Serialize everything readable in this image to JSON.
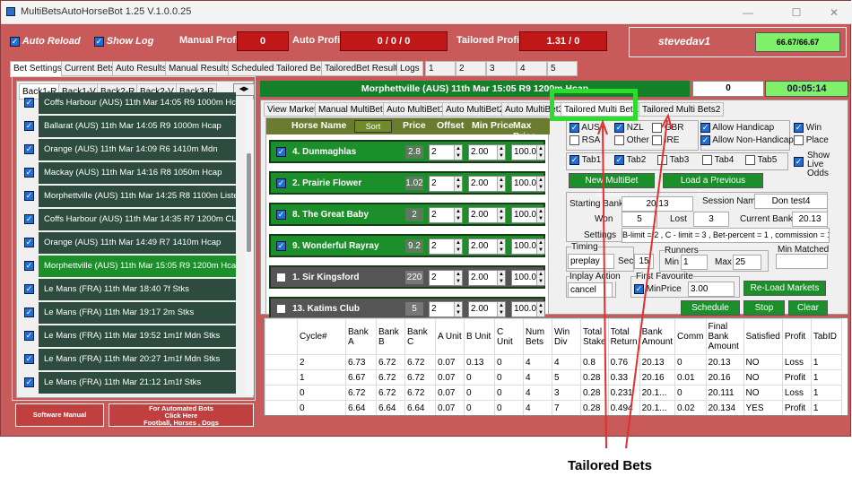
{
  "window": {
    "title": "MultiBetsAutoHorseBot 1.25 V.1.0.0.25",
    "minimize": "—",
    "maximize": "☐",
    "close": "✕"
  },
  "top": {
    "auto_reload": "Auto Reload",
    "show_log": "Show Log",
    "manual_profit_label": "Manual Profit",
    "manual_profit": "0",
    "auto_profit_label": "Auto Profit",
    "auto_profit": "0 / 0 / 0",
    "tailored_profit_label": "Tailored Profit",
    "tailored_profit": "1.31 / 0",
    "username": "stevedav1",
    "ratio": "66.67/66.67"
  },
  "tabs": [
    "Bet Settings",
    "Current Bets",
    "Auto Results",
    "Manual Results",
    "Scheduled Tailored Bets",
    "TailoredBet Results",
    "Logs",
    "1",
    "2",
    "3",
    "4",
    "5"
  ],
  "left": {
    "subtabs": [
      "Back1-R",
      "Back1-V",
      "Back2-R",
      "Back2-V",
      "Back3-R"
    ],
    "races": [
      {
        "name": "Coffs Harbour (AUS) 11th Mar 14:05 R9 1000m Hcap",
        "selected": false
      },
      {
        "name": "Ballarat (AUS) 11th Mar 14:05 R9 1000m Hcap",
        "selected": false
      },
      {
        "name": "Orange (AUS) 11th Mar 14:09 R6 1410m Mdn",
        "selected": false
      },
      {
        "name": "Mackay (AUS) 11th Mar 14:16 R8 1050m Hcap",
        "selected": false
      },
      {
        "name": "Morphettville (AUS) 11th Mar 14:25 R8 1100m Listed",
        "selected": false
      },
      {
        "name": "Coffs Harbour (AUS) 11th Mar 14:35 R7 1200m CL3",
        "selected": false
      },
      {
        "name": "Orange (AUS) 11th Mar 14:49 R7 1410m Hcap",
        "selected": false
      },
      {
        "name": "Morphettville (AUS) 11th Mar 15:05 R9 1200m Hcap",
        "selected": true
      },
      {
        "name": "Le Mans (FRA) 11th Mar 18:40 7f Stks",
        "selected": false
      },
      {
        "name": "Le Mans (FRA) 11th Mar 19:17 2m Stks",
        "selected": false
      },
      {
        "name": "Le Mans (FRA) 11th Mar 19:52 1m1f Mdn Stks",
        "selected": false
      },
      {
        "name": "Le Mans (FRA) 11th Mar 20:27 1m1f Mdn Stks",
        "selected": false
      },
      {
        "name": "Le Mans (FRA) 11th Mar 21:12 1m1f Stks",
        "selected": false
      }
    ],
    "software_manual": "Software Manual",
    "for_auto_1": "For Automated Bots",
    "for_auto_2": "Click Here",
    "for_auto_3": "Football, Horses , Dogs"
  },
  "main": {
    "header": "Morphettville (AUS) 11th Mar 15:05 R9 1200m Hcap",
    "header_count": "0",
    "timer": "00:05:14",
    "tabs": [
      "View Market",
      "Manual MultiBets",
      "Auto MultiBet1",
      "Auto MultiBet2",
      "Auto MultiBet3",
      "Tailored Multi Bets1",
      "Tailored Multi Bets2"
    ],
    "cols": {
      "horse": "Horse Name",
      "sort": "Sort",
      "price": "Price",
      "offset": "Offset",
      "min": "Min Price",
      "max": "Max Price"
    },
    "horses": [
      {
        "name": "4. Dunmaghlas",
        "price": "2.8",
        "offset": "2",
        "min": "2.00",
        "max": "100.0",
        "active": true
      },
      {
        "name": "2. Prairie Flower",
        "price": "1.02",
        "offset": "2",
        "min": "2.00",
        "max": "100.0",
        "active": true
      },
      {
        "name": "8. The Great Baby",
        "price": "2",
        "offset": "2",
        "min": "2.00",
        "max": "100.0",
        "active": true
      },
      {
        "name": "9. Wonderful Rayray",
        "price": "9.2",
        "offset": "2",
        "min": "2.00",
        "max": "100.0",
        "active": true
      },
      {
        "name": "1. Sir Kingsford",
        "price": "220",
        "offset": "2",
        "min": "2.00",
        "max": "100.0",
        "active": false
      },
      {
        "name": "13. Katims Club",
        "price": "5",
        "offset": "2",
        "min": "2.00",
        "max": "100.0",
        "active": false
      }
    ]
  },
  "settings": {
    "aus": "AUS",
    "nzl": "NZL",
    "gbr": "GBR",
    "rsa": "RSA",
    "other": "Other",
    "ire": "IRE",
    "allow_handicap": "Allow Handicap",
    "allow_nonhandicap": "Allow Non-Handicap",
    "win": "Win",
    "place": "Place",
    "show_live_odds": "Show Live Odds",
    "tab1": "Tab1",
    "tab2": "Tab2",
    "tab3": "Tab3",
    "tab4": "Tab4",
    "tab5": "Tab5",
    "new_session": "New MultiBet Session",
    "load_session": "Load a Previous Session",
    "starting_bank_lbl": "Starting Bank",
    "starting_bank": "20.13",
    "session_name_lbl": "Session Name",
    "session_name": "Don test4",
    "won_lbl": "Won",
    "won": "5",
    "lost_lbl": "Lost",
    "lost": "3",
    "current_bank_lbl": "Current Bank",
    "current_bank": "20.13",
    "settings_lbl": "Settings",
    "settings_val": "B-limit = 2 , C - limit = 3 , Bet-percent = 1 , commission = 10",
    "timing_lbl": "Timing",
    "timing": "preplay",
    "sec_lbl": "Sec",
    "sec": "15",
    "runners_lbl": "Runners",
    "min_lbl": "Min",
    "min": "1",
    "max_lbl": "Max",
    "max": "25",
    "min_matched_lbl": "Min Matched",
    "min_matched": "",
    "inplay_lbl": "Inplay Action",
    "inplay": "cancel",
    "first_fav_lbl": "First Favourite",
    "minprice_lbl": "MinPrice",
    "minprice": "3.00",
    "reload_markets": "Re-Load Markets",
    "schedule": "Schedule",
    "stop": "Stop",
    "clear": "Clear"
  },
  "grid": {
    "headers": [
      "",
      "Cycle#",
      "Bank A",
      "Bank B",
      "Bank C",
      "A Unit",
      "B Unit",
      "C Unit",
      "Num Bets",
      "Win Div",
      "Total Stake",
      "Total Return",
      "Bank Amount",
      "Comm",
      "Final Bank Amount",
      "Satisfied",
      "Profit",
      "TabID"
    ],
    "rows": [
      [
        "",
        "2",
        "6.73",
        "6.72",
        "6.72",
        "0.07",
        "0.13",
        "0",
        "4",
        "4",
        "0.8",
        "0.76",
        "20.13",
        "0",
        "20.13",
        "NO",
        "Loss",
        "1"
      ],
      [
        "",
        "1",
        "6.67",
        "6.72",
        "6.72",
        "0.07",
        "0",
        "0",
        "4",
        "5",
        "0.28",
        "0.33",
        "20.16",
        "0.01",
        "20.16",
        "NO",
        "Profit",
        "1"
      ],
      [
        "",
        "0",
        "6.72",
        "6.72",
        "6.72",
        "0.07",
        "0",
        "0",
        "4",
        "3",
        "0.28",
        "0.231",
        "20.1...",
        "0",
        "20.111",
        "NO",
        "Loss",
        "1"
      ],
      [
        "",
        "0",
        "6.64",
        "6.64",
        "6.64",
        "0.07",
        "0",
        "0",
        "4",
        "7",
        "0.28",
        "0.494",
        "20.1...",
        "0.02",
        "20.134",
        "YES",
        "Profit",
        "1"
      ]
    ]
  },
  "annotation": "Tailored Bets"
}
